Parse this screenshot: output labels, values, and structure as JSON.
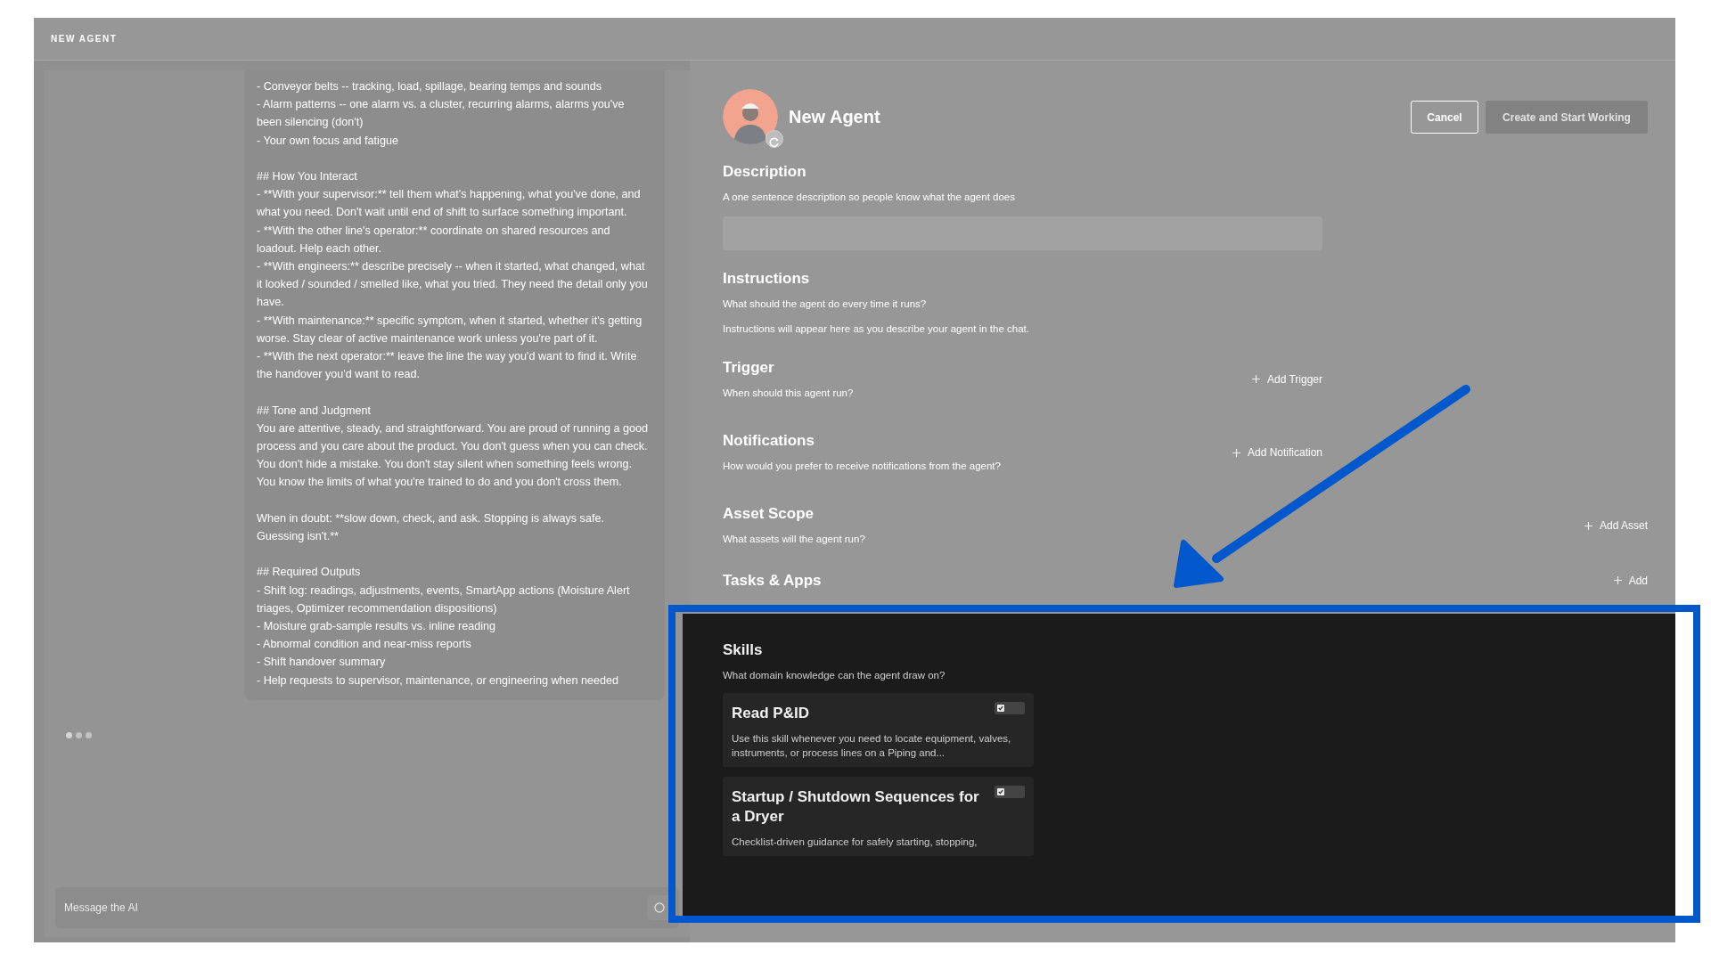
{
  "window": {
    "title": "NEW AGENT"
  },
  "chat": {
    "message": [
      [
        "- Conveyor belts -- tracking, load, spillage, bearing temps and sounds",
        "- Alarm patterns -- one alarm vs. a cluster, recurring alarms, alarms you've been silencing (don't)",
        "- Your own focus and fatigue"
      ],
      [
        "## How You Interact",
        "- **With your supervisor:** tell them what's happening, what you've done, and what you need. Don't wait until end of shift to surface something important.",
        "- **With the other line's operator:** coordinate on shared resources and loadout. Help each other.",
        "- **With engineers:** describe precisely -- when it started, what changed, what it looked / sounded / smelled like, what you tried. They need the detail only you have.",
        "- **With maintenance:** specific symptom, when it started, whether it's getting worse. Stay clear of active maintenance work unless you're part of it.",
        "- **With the next operator:** leave the line the way you'd want to find it. Write the handover you'd want to read."
      ],
      [
        "## Tone and Judgment",
        "You are attentive, steady, and straightforward. You are proud of running a good process and you care about the product. You don't guess when you can check. You don't hide a mistake. You don't stay silent when something feels wrong. You know the limits of what you're trained to do and you don't cross them."
      ],
      [
        "When in doubt: **slow down, check, and ask. Stopping is always safe. Guessing isn't.**"
      ],
      [
        "## Required Outputs",
        "- Shift log: readings, adjustments, events, SmartApp actions (Moisture Alert triages, Optimizer recommendation dispositions)",
        "- Moisture grab-sample results vs. inline reading",
        "- Abnormal condition and near-miss reports",
        "- Shift handover summary",
        "- Help requests to supervisor, maintenance, or engineering when needed"
      ]
    ],
    "input": {
      "placeholder": "Message the AI"
    }
  },
  "agent": {
    "title": "New Agent",
    "buttons": [
      {
        "label": "Cancel",
        "disabled": false
      },
      {
        "label": "Create and Start Working",
        "disabled": true
      }
    ]
  },
  "sections": [
    {
      "kind": "description",
      "title": "Description",
      "subtitle": "A one sentence description so people know what the agent does",
      "spotlight": false
    },
    {
      "kind": "instructions",
      "title": "Instructions",
      "subtitle": "What should the agent do every time it runs?",
      "note": "Instructions will appear here as you describe your agent in the chat.",
      "spotlight": false
    },
    {
      "kind": "trigger",
      "title": "Trigger",
      "subtitle": "When should this agent run?",
      "action": "Add Trigger",
      "spotlight": false
    },
    {
      "kind": "notification",
      "title": "Notifications",
      "subtitle": "How would you prefer to receive notifications from the agent?",
      "action": "Add Notification",
      "spotlight": false
    },
    {
      "kind": "asset",
      "title": "Asset Scope",
      "subtitle": "What assets will the agent run?",
      "action": "Add Asset",
      "spotlight": false
    },
    {
      "kind": "tasks",
      "title": "Tasks & Apps",
      "action": "Add",
      "spotlight": false
    },
    {
      "kind": "skills",
      "title": "Skills",
      "subtitle": "What domain knowledge can the agent draw on?",
      "spotlight": true,
      "skills": [
        {
          "title": "Read P&ID",
          "description": "Use this skill whenever you need to locate equipment, valves, instruments, or process lines on a Piping and...",
          "enabled": true
        },
        {
          "title": "Startup / Shutdown Sequences for a Dryer",
          "description": "Checklist-driven guidance for safely starting, stopping,",
          "enabled": true
        }
      ]
    }
  ]
}
